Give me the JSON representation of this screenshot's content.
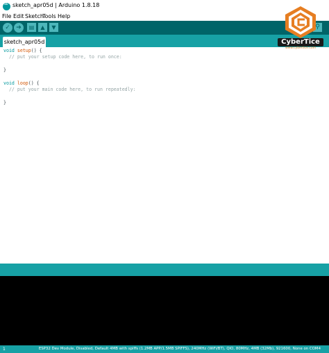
{
  "window": {
    "title": "sketch_apr05d | Arduino 1.8.18"
  },
  "menu": {
    "items": [
      "File",
      "Edit",
      "Sketch",
      "Tools",
      "Help"
    ]
  },
  "toolbar": {
    "verify_icon": "checkmark-icon",
    "upload_icon": "arrow-right-icon",
    "new_icon": "new-file-icon",
    "open_icon": "arrow-up-icon",
    "save_icon": "arrow-down-icon",
    "serial_icon": "magnifier-icon"
  },
  "tabs": [
    {
      "label": "sketch_apr05d"
    }
  ],
  "editor": {
    "lines": [
      "void setup() {",
      "  // put your setup code here, to run once:",
      "",
      "}",
      "",
      "void loop() {",
      "  // put your main code here, to run repeatedly:",
      "",
      "}"
    ]
  },
  "status": {
    "line_number": "1",
    "board_info": "ESP32 Dev Module, Disabled, Default 4MB with spiffs (1.2MB APP/1.5MB SPIFFS), 240MHz (WiFi/BT), QIO, 80MHz, 4MB (32Mb), 921600, None on COM4"
  },
  "watermark": {
    "brand": "CyberTice",
    "url": "www.cybertice.com"
  },
  "colors": {
    "toolbar_bg": "#006468",
    "tabbar_bg": "#17a1a5",
    "button_bg": "#4db7bb",
    "keyword": "#00979c",
    "function": "#d35400",
    "comment": "#95a5a6",
    "console_bg": "#000000"
  }
}
